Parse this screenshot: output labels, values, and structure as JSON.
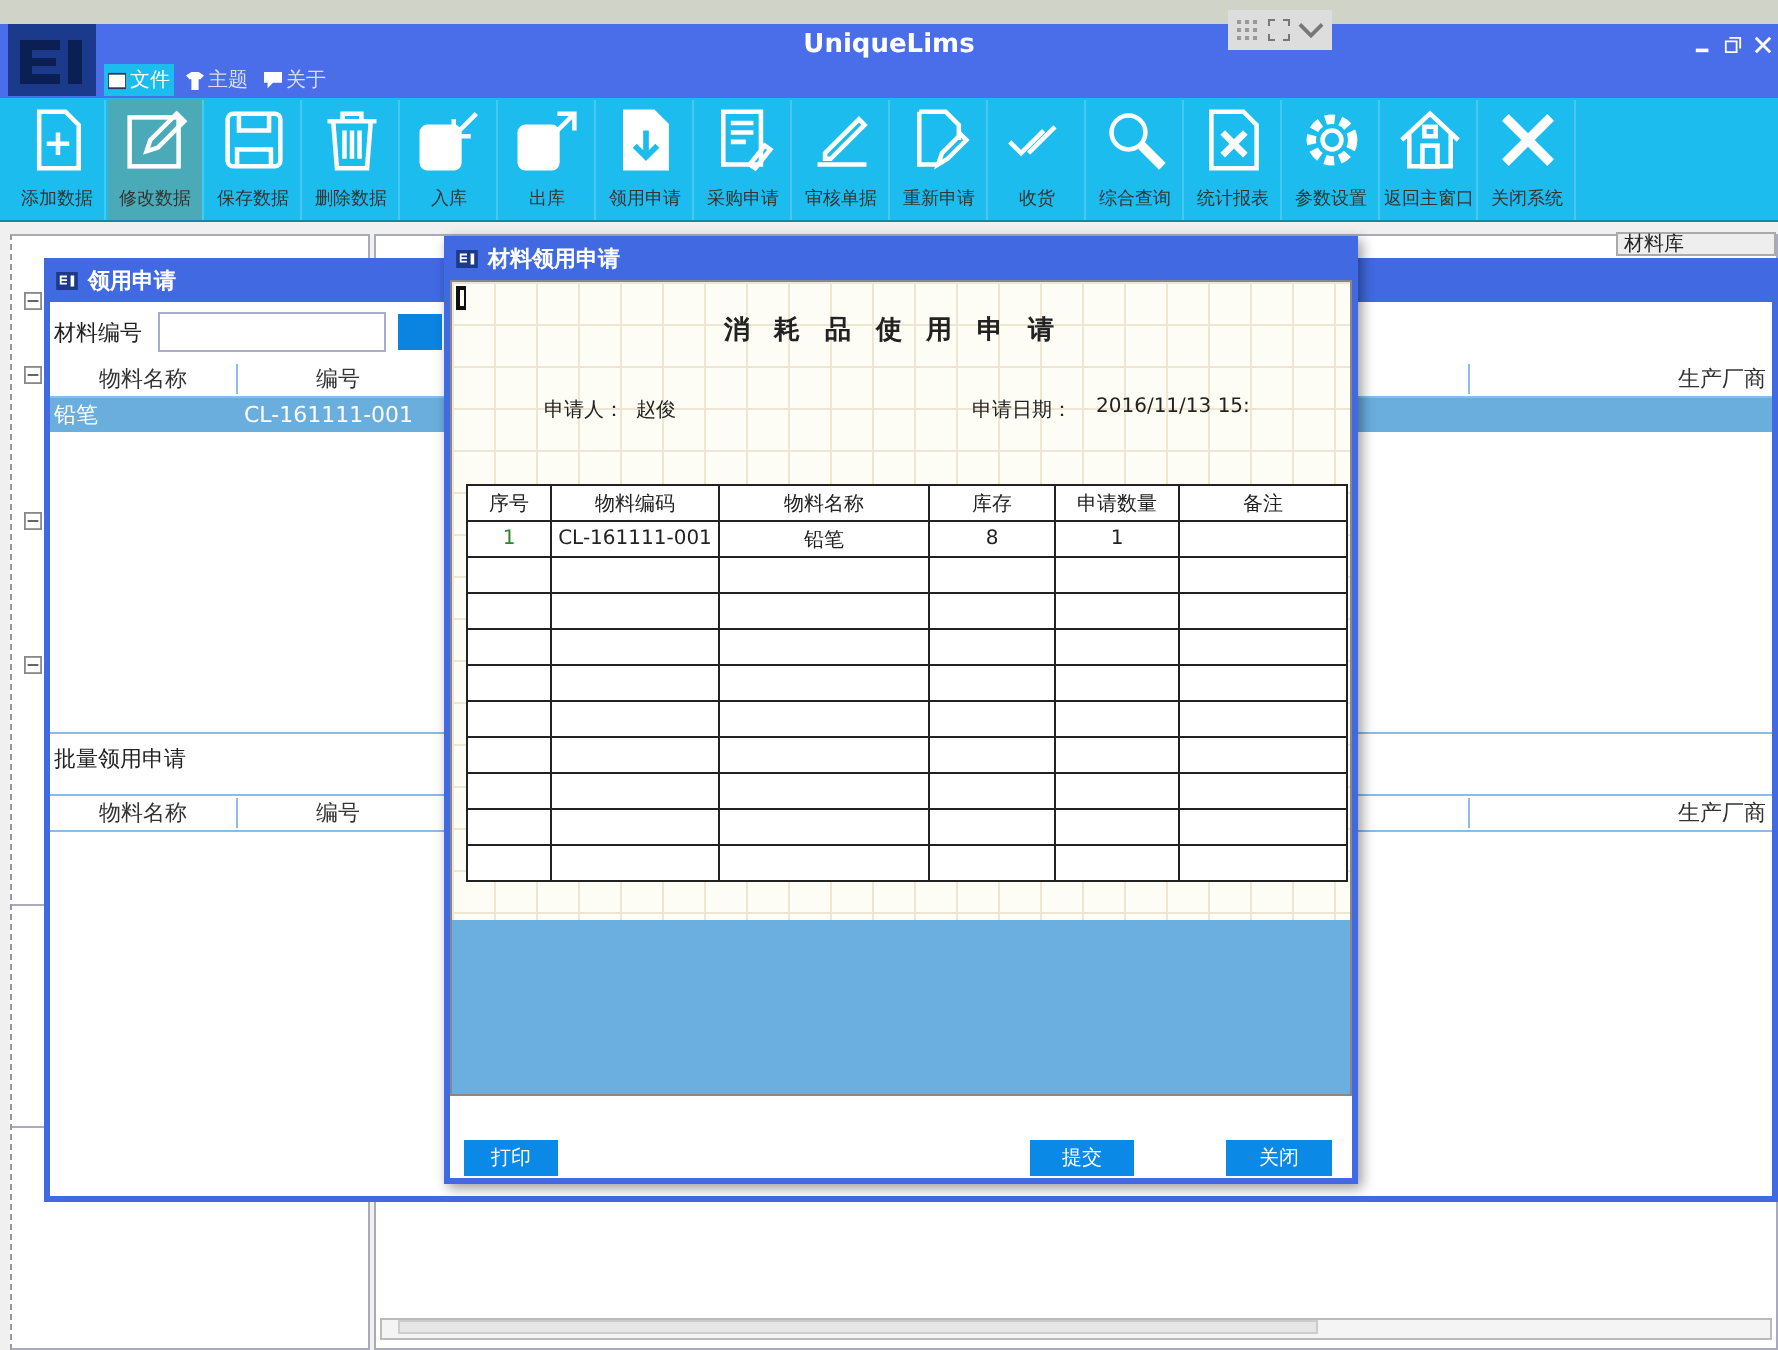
{
  "app": {
    "title": "UniqueLims"
  },
  "menu": [
    {
      "label": "文件",
      "selected": true
    },
    {
      "label": "主题",
      "selected": false
    },
    {
      "label": "关于",
      "selected": false
    }
  ],
  "toolbar": [
    {
      "label": "添加数据",
      "kind": "add",
      "selected": false
    },
    {
      "label": "修改数据",
      "kind": "edit",
      "selected": true
    },
    {
      "label": "保存数据",
      "kind": "save",
      "selected": false
    },
    {
      "label": "删除数据",
      "kind": "delete",
      "selected": false
    },
    {
      "label": "入库",
      "kind": "in",
      "selected": false
    },
    {
      "label": "出库",
      "kind": "out",
      "selected": false
    },
    {
      "label": "领用申请",
      "kind": "requisition",
      "selected": false
    },
    {
      "label": "采购申请",
      "kind": "purchase",
      "selected": false
    },
    {
      "label": "审核单据",
      "kind": "review",
      "selected": false
    },
    {
      "label": "重新申请",
      "kind": "reapply",
      "selected": false
    },
    {
      "label": "收货",
      "kind": "receive",
      "selected": false
    },
    {
      "label": "综合查询",
      "kind": "search",
      "selected": false
    },
    {
      "label": "统计报表",
      "kind": "report",
      "selected": false
    },
    {
      "label": "参数设置",
      "kind": "settings",
      "selected": false
    },
    {
      "label": "返回主窗口",
      "kind": "home",
      "selected": false
    },
    {
      "label": "关闭系统",
      "kind": "close",
      "selected": false
    }
  ],
  "workspace": {
    "dropdown": {
      "value": "材料库"
    }
  },
  "requisition_window": {
    "title": "领用申请",
    "search": {
      "label": "材料编号"
    },
    "columns": [
      "物料名称",
      "编号",
      "生产厂商"
    ],
    "rows": [
      {
        "cells": [
          "铅笔",
          "CL-161111-001"
        ],
        "selected": true
      }
    ],
    "batch": {
      "label": "批量领用申请",
      "columns": [
        "物料名称",
        "编号",
        "生产厂商"
      ]
    }
  },
  "dialog": {
    "title": "材料领用申请",
    "form_title": "消耗品使用申请",
    "applicant_label": "申请人：",
    "applicant": "赵俊",
    "date_label": "申请日期：",
    "date": "2016/11/13 15:",
    "columns": [
      "序号",
      "物料编码",
      "物料名称",
      "库存",
      "申请数量",
      "备注"
    ],
    "rows": [
      {
        "cells": [
          "1",
          "CL-161111-001",
          "铅笔",
          "8",
          "1"
        ]
      }
    ],
    "buttons": [
      {
        "label": "打印"
      },
      {
        "label": "提交"
      },
      {
        "label": "关闭"
      }
    ]
  }
}
